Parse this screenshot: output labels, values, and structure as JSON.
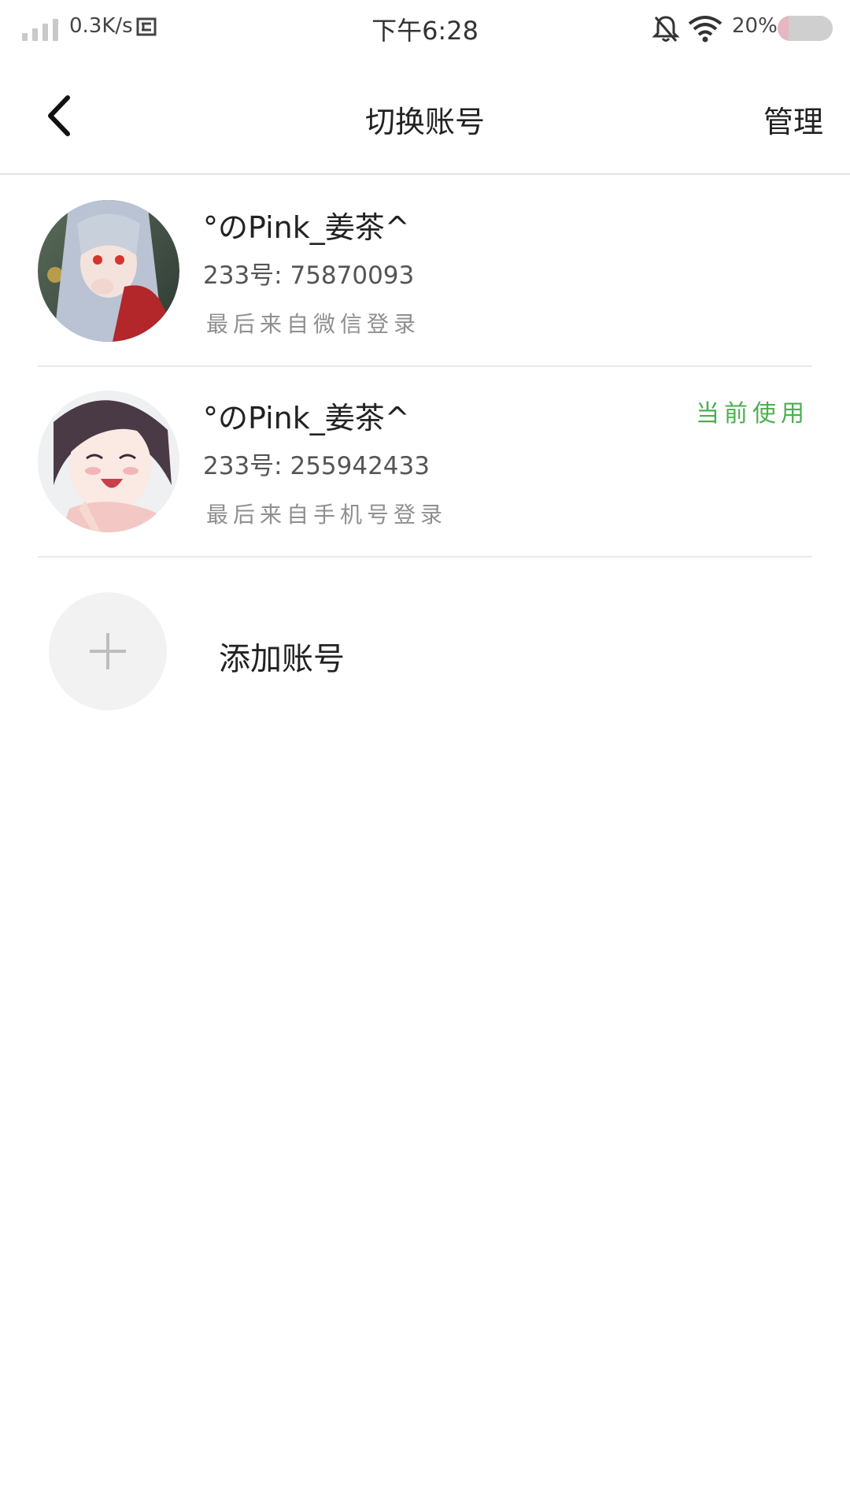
{
  "status_bar": {
    "network_speed": "0.3K/s",
    "time": "下午6:28",
    "battery_percent_text": "20%",
    "battery_level": 0.2,
    "icons": [
      "signal-icon",
      "screenshot-icon",
      "bell-off-icon",
      "wifi-icon",
      "battery-icon"
    ]
  },
  "header": {
    "title": "切换账号",
    "manage_label": "管理",
    "back_icon": "chevron-left-icon"
  },
  "accounts": [
    {
      "name": "°のPink_姜茶^",
      "id_text": "233号: 75870093",
      "login_text": "最后来自微信登录",
      "current_label": ""
    },
    {
      "name": "°のPink_姜茶^",
      "id_text": "233号: 255942433",
      "login_text": "最后来自手机号登录",
      "current_label": "当前使用"
    }
  ],
  "add_account": {
    "label": "添加账号",
    "icon": "plus-icon"
  },
  "colors": {
    "accent_green": "#4caf50",
    "divider": "#e9e9e9",
    "secondary_text": "#8f8f8f"
  }
}
